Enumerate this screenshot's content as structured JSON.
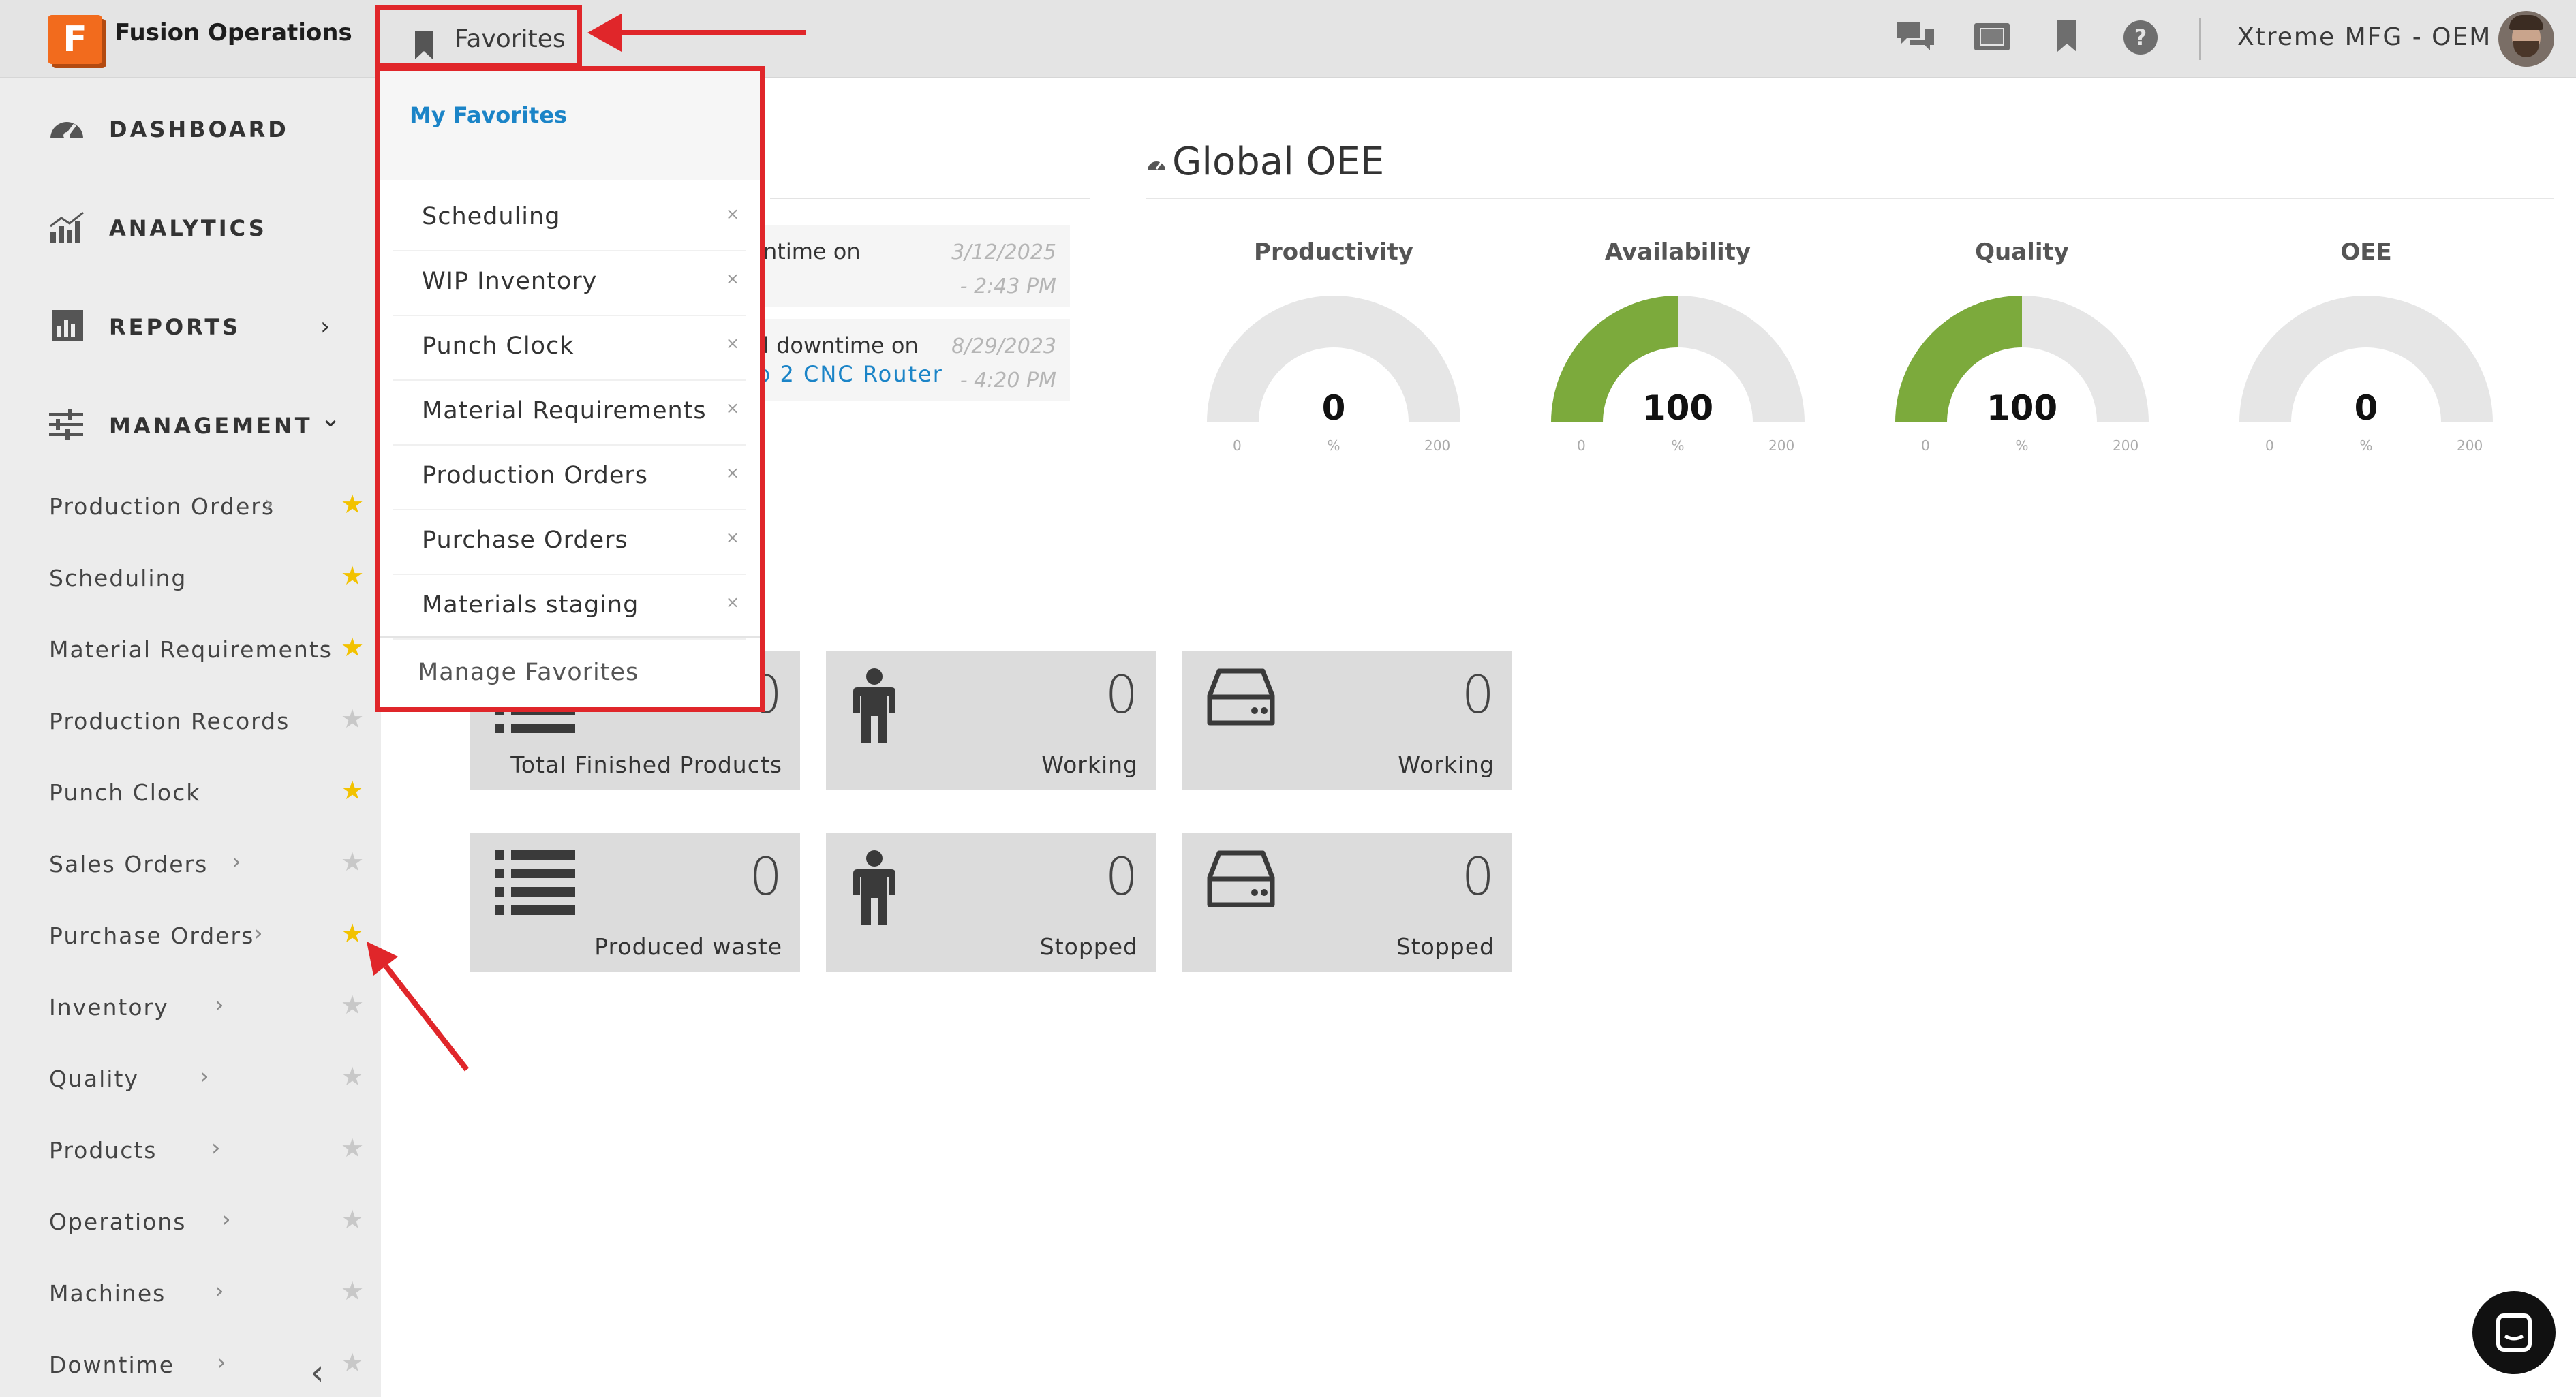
{
  "topbar": {
    "logo_letter": "F",
    "app_title": "Fusion Operations",
    "favorites_label": "Favorites",
    "company": "Xtreme MFG - OEM",
    "icons": [
      "chat-icon",
      "screen-icon",
      "bookmark-icon",
      "help-icon"
    ]
  },
  "sidebar": {
    "main": [
      {
        "label": "DASHBOARD",
        "icon": "dashboard-icon"
      },
      {
        "label": "ANALYTICS",
        "icon": "analytics-icon"
      },
      {
        "label": "REPORTS",
        "icon": "reports-icon",
        "chevron": "›"
      },
      {
        "label": "MANAGEMENT",
        "icon": "management-icon",
        "chevron": "⌄"
      }
    ],
    "items": [
      {
        "label": "Production Orders",
        "starred": true
      },
      {
        "label": "Scheduling",
        "starred": true
      },
      {
        "label": "Material Requirements",
        "starred": true
      },
      {
        "label": "Production Records",
        "starred": false
      },
      {
        "label": "Punch Clock",
        "starred": true
      },
      {
        "label": "Sales Orders",
        "starred": false
      },
      {
        "label": "Purchase Orders",
        "starred": true
      },
      {
        "label": "Inventory",
        "starred": false
      },
      {
        "label": "Quality",
        "starred": false
      },
      {
        "label": "Products",
        "starred": false
      },
      {
        "label": "Operations",
        "starred": false
      },
      {
        "label": "Machines",
        "starred": false
      },
      {
        "label": "Downtime",
        "starred": false
      }
    ],
    "arrow": "›",
    "star": "★",
    "collapse": "‹"
  },
  "favorites_menu": {
    "header": "My Favorites",
    "items": [
      "Scheduling",
      "WIP Inventory",
      "Punch Clock",
      "Material Requirements",
      "Production Orders",
      "Purchase Orders",
      "Materials staging"
    ],
    "remove_glyph": "×",
    "manage": "Manage Favorites"
  },
  "notifications": [
    {
      "text": "ntime on",
      "link": "",
      "date": "3/12/2025",
      "time": "- 2:43 PM"
    },
    {
      "text": "l downtime on",
      "link": "p 2 CNC Router",
      "date": "8/29/2023",
      "time": "- 4:20 PM"
    }
  ],
  "oee": {
    "title": "Global OEE",
    "gauges": [
      {
        "title": "Productivity",
        "value": 0,
        "display": "0",
        "unit": "%",
        "min": "0",
        "max": "200"
      },
      {
        "title": "Availability",
        "value": 100,
        "display": "100",
        "unit": "%",
        "min": "0",
        "max": "200"
      },
      {
        "title": "Quality",
        "value": 100,
        "display": "100",
        "unit": "%",
        "min": "0",
        "max": "200"
      },
      {
        "title": "OEE",
        "value": 0,
        "display": "0",
        "unit": "%",
        "min": "0",
        "max": "200"
      }
    ],
    "gauge_max": 200,
    "fill_color": "#7caa3c",
    "track_color": "#e6e6e6"
  },
  "cards": [
    {
      "value": "0",
      "label": "Total Finished Products",
      "icon": "list-icon"
    },
    {
      "value": "0",
      "label": "Working",
      "icon": "person-icon"
    },
    {
      "value": "0",
      "label": "Working",
      "icon": "machine-icon"
    },
    {
      "value": "0",
      "label": "Produced waste",
      "icon": "list-icon"
    },
    {
      "value": "0",
      "label": "Stopped",
      "icon": "person-icon"
    },
    {
      "value": "0",
      "label": "Stopped",
      "icon": "machine-icon"
    }
  ],
  "colors": {
    "accent": "#1b84c7",
    "annotation": "#e0262a",
    "star": "#f2c200",
    "logo": "#f26b1d"
  }
}
